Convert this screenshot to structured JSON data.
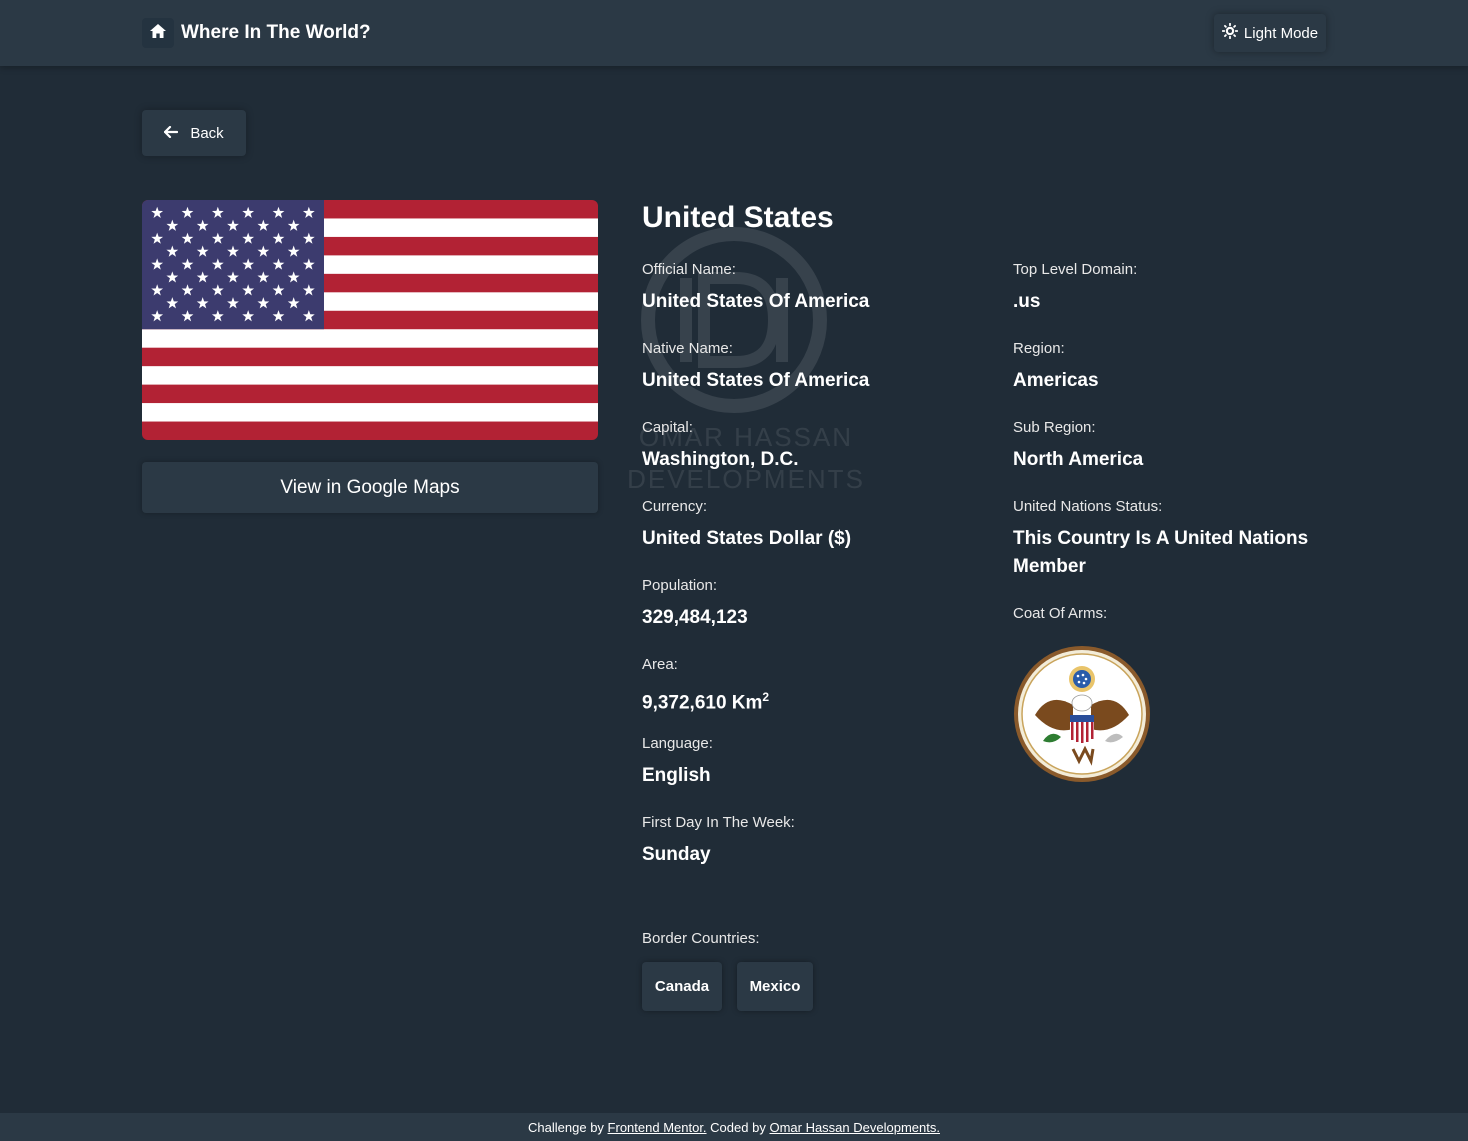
{
  "header": {
    "title": "Where In The World?",
    "mode_label": "Light Mode"
  },
  "back_label": "Back",
  "flag": {
    "country": "United States",
    "colors": {
      "red": "#b22234",
      "white": "#ffffff",
      "blue": "#3c3b6e"
    }
  },
  "maps_label": "View in Google Maps",
  "country_name": "United States",
  "left_fields": [
    {
      "label": "Official Name:",
      "value": "United States Of America"
    },
    {
      "label": "Native Name:",
      "value": "United States Of America"
    },
    {
      "label": "Capital:",
      "value": "Washington, D.C."
    },
    {
      "label": "Currency:",
      "value": "United States Dollar ($)"
    },
    {
      "label": "Population:",
      "value": "329,484,123"
    },
    {
      "label": "Area:",
      "value": "9,372,610 Km",
      "sup": "2"
    },
    {
      "label": "Language:",
      "value": "English"
    },
    {
      "label": "First Day In The Week:",
      "value": "Sunday"
    }
  ],
  "right_fields": [
    {
      "label": "Top Level Domain:",
      "value": ".us"
    },
    {
      "label": "Region:",
      "value": "Americas"
    },
    {
      "label": "Sub Region:",
      "value": "North America"
    },
    {
      "label": "United Nations Status:",
      "value": "This Country Is A United Nations Member"
    }
  ],
  "coat_of_arms_label": "Coat Of Arms:",
  "border_label": "Border Countries:",
  "border_countries": [
    "Canada",
    "Mexico"
  ],
  "watermark": {
    "initials": "OD",
    "line1": "OMAR HASSAN",
    "line2": "DEVELOPMENTS"
  },
  "footer": {
    "prefix": "Challenge by",
    "link1": "Frontend Mentor.",
    "middle": "Coded by",
    "link2": "Omar Hassan Developments."
  },
  "colors": {
    "background": "#202c37",
    "elements": "#2b3945",
    "text": "#ffffff"
  }
}
